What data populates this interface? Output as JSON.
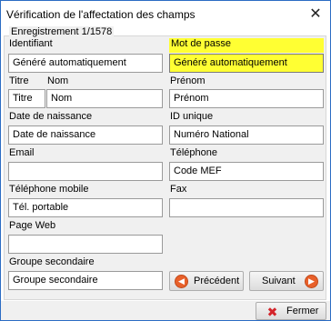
{
  "window": {
    "title": "Vérification de l'affectation des champs",
    "close_glyph": "✕"
  },
  "group": {
    "title": "Enregistrement 1/1578"
  },
  "fields": {
    "identifiant": {
      "label": "Identifiant",
      "value": "Généré automatiquement"
    },
    "mot_de_passe": {
      "label": "Mot de passe",
      "value": "Généré automatiquement"
    },
    "titre": {
      "label": "Titre",
      "value": "Titre"
    },
    "nom": {
      "label": "Nom",
      "value": "Nom"
    },
    "prenom": {
      "label": "Prénom",
      "value": "Prénom"
    },
    "date_naissance": {
      "label": "Date de naissance",
      "value": "Date de naissance"
    },
    "id_unique": {
      "label": "ID unique",
      "value": "Numéro National"
    },
    "email": {
      "label": "Email",
      "value": ""
    },
    "telephone": {
      "label": "Téléphone",
      "value": "Code MEF"
    },
    "telephone_mobile": {
      "label": "Téléphone mobile",
      "value": "Tél. portable"
    },
    "fax": {
      "label": "Fax",
      "value": ""
    },
    "page_web": {
      "label": "Page Web",
      "value": ""
    },
    "groupe_secondaire": {
      "label": "Groupe secondaire",
      "value": "Groupe secondaire"
    }
  },
  "buttons": {
    "precedent": {
      "label": "Précédent",
      "icon": "arrow-left-icon"
    },
    "suivant": {
      "label": "Suivant",
      "icon": "arrow-right-icon"
    },
    "fermer": {
      "label": "Fermer",
      "icon": "close-icon"
    }
  },
  "colors": {
    "highlight": "#ffff33",
    "accent_orange": "#e8602a",
    "close_red": "#d4242a"
  }
}
